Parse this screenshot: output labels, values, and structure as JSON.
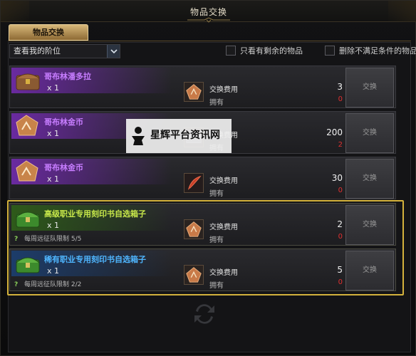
{
  "window": {
    "title": "物品交换"
  },
  "tabs": [
    {
      "label": "物品交换",
      "active": true
    }
  ],
  "filters": {
    "tier_select": {
      "value": "查看我的阶位"
    },
    "checkbox_remaining": {
      "label": "只看有剩余的物品",
      "checked": false
    },
    "checkbox_hide_unmet": {
      "label": "删除不满足条件的物品",
      "checked": false
    }
  },
  "items": [
    {
      "name": "哥布林潘多拉",
      "name_color": "#c77dff",
      "qty": "x 1",
      "cost_label": "交换费用",
      "own_label": "拥有",
      "cost": "3",
      "owned": "0",
      "button": "交换",
      "icon": "chest-icon",
      "weekly": ""
    },
    {
      "name": "哥布林金币",
      "name_color": "#c77dff",
      "qty": "x 1",
      "cost_label": "交换费用",
      "own_label": "拥有",
      "cost": "200",
      "owned": "2",
      "button": "交换",
      "icon": "coin-icon",
      "weekly": ""
    },
    {
      "name": "哥布林金币",
      "name_color": "#c77dff",
      "qty": "x 1",
      "cost_label": "交换费用",
      "own_label": "拥有",
      "cost": "30",
      "owned": "0",
      "button": "交换",
      "icon": "coin-icon",
      "weekly": ""
    },
    {
      "name": "高级职业专用刻印书自选箱子",
      "name_color": "#c8e84a",
      "qty": "x 1",
      "cost_label": "交换费用",
      "own_label": "拥有",
      "cost": "2",
      "owned": "0",
      "button": "交换",
      "icon": "green-chest-icon",
      "weekly": "每周远征队限制 5/5"
    },
    {
      "name": "稀有职业专用刻印书自选箱子",
      "name_color": "#4fb6ff",
      "qty": "x 1",
      "cost_label": "交换费用",
      "own_label": "拥有",
      "cost": "5",
      "owned": "0",
      "button": "交换",
      "icon": "green-chest-icon",
      "weekly": "每周远征队限制 2/2"
    }
  ],
  "watermark": {
    "text": "星辉平台资讯网"
  },
  "colors": {
    "gold_frame": "#d4b23c",
    "owned_red": "#e03030",
    "tab_gold": "#c9a86a"
  }
}
